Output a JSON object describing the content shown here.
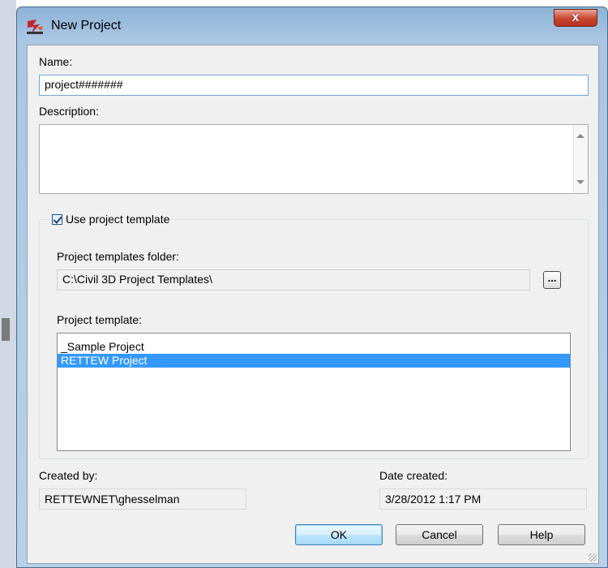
{
  "window": {
    "title": "New Project",
    "close_label": "x"
  },
  "form": {
    "name_label": "Name:",
    "name_value": "project#######",
    "description_label": "Description:",
    "description_value": "",
    "use_template_label": "Use project template",
    "use_template_checked": true,
    "templates_folder_label": "Project templates folder:",
    "templates_folder_value": "C:\\Civil 3D Project Templates\\",
    "browse_label": "...",
    "template_label": "Project template:",
    "templates": [
      {
        "label": "_Sample Project",
        "selected": false
      },
      {
        "label": "RETTEW Project",
        "selected": true
      }
    ],
    "created_by_label": "Created by:",
    "created_by_value": "RETTEWNET\\ghesselman",
    "date_created_label": "Date created:",
    "date_created_value": "3/28/2012 1:17 PM"
  },
  "buttons": {
    "ok": "OK",
    "cancel": "Cancel",
    "help": "Help"
  },
  "colors": {
    "selection": "#3399ff",
    "close_button": "#c9442e",
    "title_bar": "#aac6e2"
  },
  "icons": {
    "app": "civil3d-app-icon",
    "close": "close-icon",
    "browse": "ellipsis-icon"
  }
}
